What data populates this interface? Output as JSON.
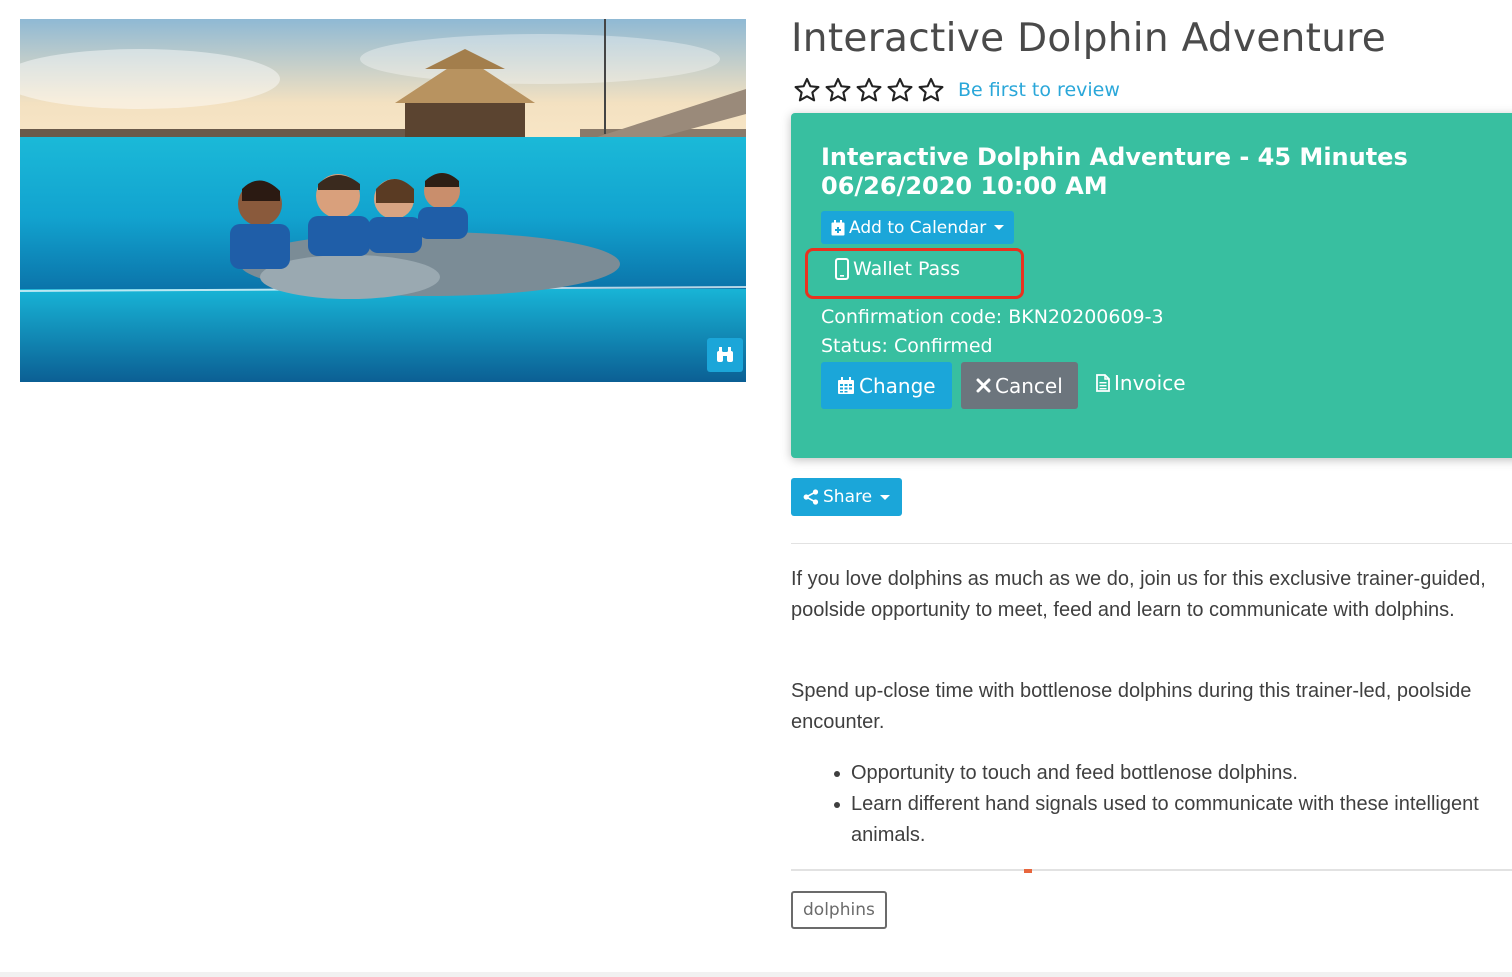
{
  "product": {
    "title": "Interactive Dolphin Adventure",
    "rating": {
      "stars_filled": 0,
      "stars_total": 5,
      "review_link": "Be first to review"
    }
  },
  "hero_image": {
    "gallery_icon": "binoculars-icon"
  },
  "booking": {
    "title": "Interactive Dolphin Adventure - 45 Minutes 06/26/2020 10:00 AM",
    "add_to_calendar_label": "Add to Calendar",
    "wallet_pass_label": "Wallet Pass",
    "confirmation_line": "Confirmation code: BKN20200609-3",
    "status_line": "Status: Confirmed",
    "change_label": "Change",
    "cancel_label": "Cancel",
    "invoice_label": "Invoice"
  },
  "share_label": "Share",
  "description": {
    "paragraphs": [
      "If you love dolphins as much as we do, join us for this exclusive trainer-guided, poolside opportunity to meet, feed and learn to communicate with dolphins.",
      "Spend up-close time with bottlenose dolphins during this trainer-led, poolside encounter."
    ],
    "bullets": [
      "Opportunity to touch and feed bottlenose dolphins.",
      "Learn different hand signals used to communicate with these intelligent animals."
    ]
  },
  "tags": [
    "dolphins"
  ],
  "colors": {
    "card": "#38bfa0",
    "primary": "#1ba6d9",
    "secondary": "#6c757d",
    "highlight": "#e8321f",
    "link": "#2aa7d9"
  }
}
